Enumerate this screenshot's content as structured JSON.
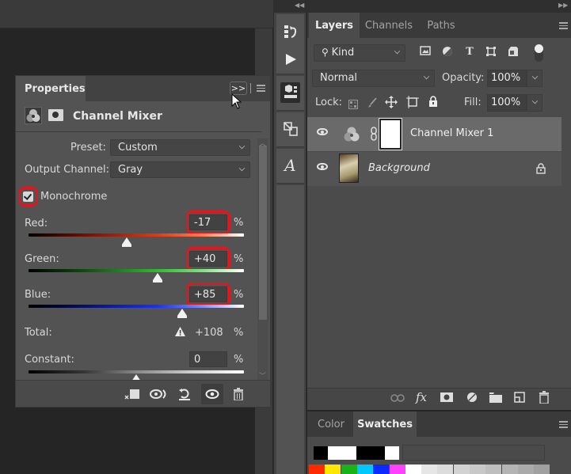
{
  "properties_panel": {
    "tab_label": "Properties",
    "collapse_label": ">>",
    "adjustment_title": "Channel Mixer",
    "preset": {
      "label": "Preset:",
      "value": "Custom"
    },
    "output_channel": {
      "label": "Output Channel:",
      "value": "Gray"
    },
    "monochrome": {
      "label": "Monochrome",
      "checked": true
    },
    "channels": [
      {
        "label": "Red:",
        "value": "-17",
        "unit": "%",
        "slider_percent": -17,
        "gradient_color": "#e03a16"
      },
      {
        "label": "Green:",
        "value": "+40",
        "unit": "%",
        "slider_percent": 40,
        "gradient_color": "#2fbb2f"
      },
      {
        "label": "Blue:",
        "value": "+85",
        "unit": "%",
        "slider_percent": 85,
        "gradient_color": "#2242ff"
      }
    ],
    "total": {
      "label": "Total:",
      "value": "+108",
      "unit": "%",
      "warning_icon": "warning-triangle-icon"
    },
    "constant": {
      "label": "Constant:",
      "value": "0",
      "unit": "%",
      "slider_percent": 0
    },
    "footer_buttons": [
      {
        "name": "clip-to-layer-button",
        "icon": "clip-icon",
        "glyph": "⬛"
      },
      {
        "name": "view-previous-button",
        "icon": "view-previous-icon",
        "glyph": "👁"
      },
      {
        "name": "reset-button",
        "icon": "reset-icon",
        "glyph": "↺"
      },
      {
        "name": "toggle-visibility-button",
        "icon": "eye-icon",
        "glyph": "👁"
      },
      {
        "name": "delete-adjustment-button",
        "icon": "trash-icon",
        "glyph": "🗑"
      }
    ],
    "highlight_color": "#e3151d"
  },
  "layers_panel": {
    "tabs": [
      {
        "label": "Layers",
        "active": true
      },
      {
        "label": "Channels",
        "active": false
      },
      {
        "label": "Paths",
        "active": false
      }
    ],
    "filter": {
      "kind_label": "Kind",
      "icons": [
        "image-filter-icon",
        "adjustment-filter-icon",
        "type-filter-icon",
        "shape-filter-icon",
        "smart-object-filter-icon"
      ]
    },
    "blend_mode": "Normal",
    "opacity": {
      "label": "Opacity:",
      "value": "100%"
    },
    "lock": {
      "label": "Lock:",
      "icons": [
        "lock-transparent-icon",
        "lock-paint-icon",
        "lock-move-icon",
        "lock-artboard-icon",
        "lock-all-icon"
      ]
    },
    "fill": {
      "label": "Fill:",
      "value": "100%"
    },
    "layers": [
      {
        "name": "Channel Mixer 1",
        "visible": true,
        "selected": true,
        "type": "adjustment"
      },
      {
        "name": "Background",
        "visible": true,
        "selected": false,
        "type": "image",
        "locked": true
      }
    ],
    "footer_icons": [
      "link-layers-icon",
      "fx-icon",
      "add-mask-icon",
      "new-adjustment-icon",
      "new-group-icon",
      "new-layer-icon",
      "delete-layer-icon"
    ]
  },
  "swatches_panel": {
    "tabs": [
      {
        "label": "Color",
        "active": false
      },
      {
        "label": "Swatches",
        "active": true
      }
    ],
    "recent": [
      "#000000",
      "#ffffff",
      "#ffffff",
      "#000000",
      "#000000",
      "#ffffff"
    ],
    "row": [
      "#ff2a00",
      "#ffe600",
      "#19b319",
      "#00c8ff",
      "#0a2aff",
      "#ff40ff",
      "#ffffff",
      "#e6e6e6",
      "#dcdcdc",
      "#d2d2d2",
      "#c8c8c8",
      "#bebebe",
      "#b4b4b4",
      "#aaaaaa",
      "#a0a0a0"
    ]
  },
  "toolstrip": {
    "icons": [
      "history-icon",
      "actions-play-icon",
      "libraries-icon",
      "paragraph-styles-icon",
      "character-styles-icon"
    ]
  }
}
